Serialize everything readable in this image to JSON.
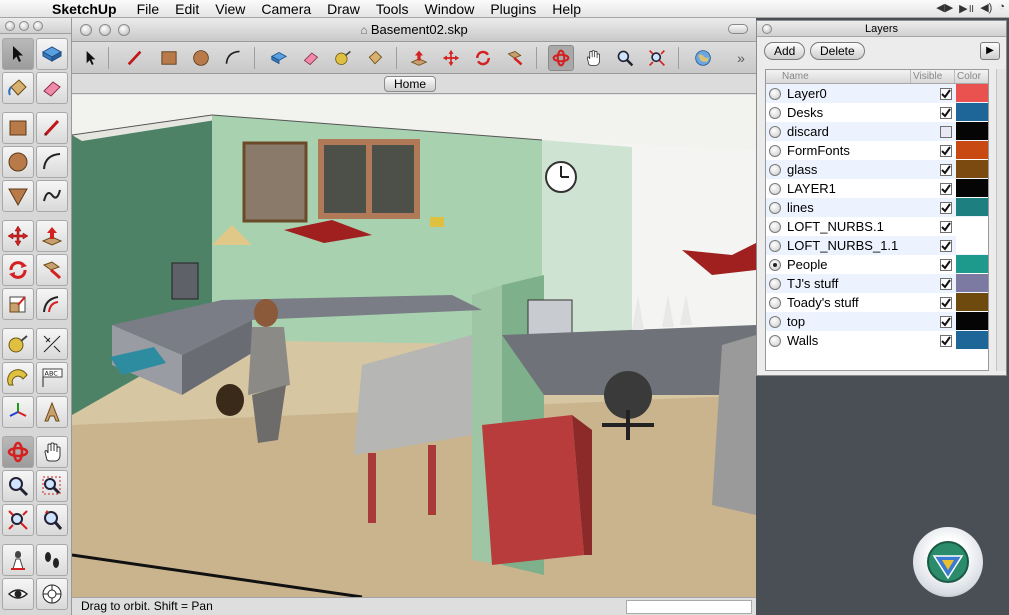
{
  "menubar": {
    "app": "SketchUp",
    "items": [
      "File",
      "Edit",
      "View",
      "Camera",
      "Draw",
      "Tools",
      "Window",
      "Plugins",
      "Help"
    ]
  },
  "window": {
    "title": "Basement02.skp"
  },
  "scenes": {
    "active_tab": "Home"
  },
  "status": {
    "text": "Drag to orbit.  Shift = Pan"
  },
  "layers_panel": {
    "title": "Layers",
    "add_label": "Add",
    "delete_label": "Delete",
    "detail_label": "▶",
    "columns": {
      "name": "Name",
      "visible": "Visible",
      "color": "Color"
    },
    "layers": [
      {
        "name": "Layer0",
        "visible": true,
        "active": false,
        "color": "#e9524e"
      },
      {
        "name": "Desks",
        "visible": true,
        "active": false,
        "color": "#1e6598"
      },
      {
        "name": "discard",
        "visible": false,
        "active": false,
        "color": "#050505"
      },
      {
        "name": "FormFonts",
        "visible": true,
        "active": false,
        "color": "#c84a12"
      },
      {
        "name": "glass",
        "visible": true,
        "active": false,
        "color": "#7a4a10"
      },
      {
        "name": "LAYER1",
        "visible": true,
        "active": false,
        "color": "#050505"
      },
      {
        "name": "lines",
        "visible": true,
        "active": false,
        "color": "#1e7f80"
      },
      {
        "name": "LOFT_NURBS.1",
        "visible": true,
        "active": false,
        "color": "#ffffff"
      },
      {
        "name": "LOFT_NURBS_1.1",
        "visible": true,
        "active": false,
        "color": "#ffffff"
      },
      {
        "name": "People",
        "visible": true,
        "active": true,
        "color": "#1e9a8c"
      },
      {
        "name": "TJ's stuff",
        "visible": true,
        "active": false,
        "color": "#7c7aa2"
      },
      {
        "name": "Toady's stuff",
        "visible": true,
        "active": false,
        "color": "#6e4a0e"
      },
      {
        "name": "top",
        "visible": true,
        "active": false,
        "color": "#050505"
      },
      {
        "name": "Walls",
        "visible": true,
        "active": false,
        "color": "#1e6598"
      }
    ]
  }
}
